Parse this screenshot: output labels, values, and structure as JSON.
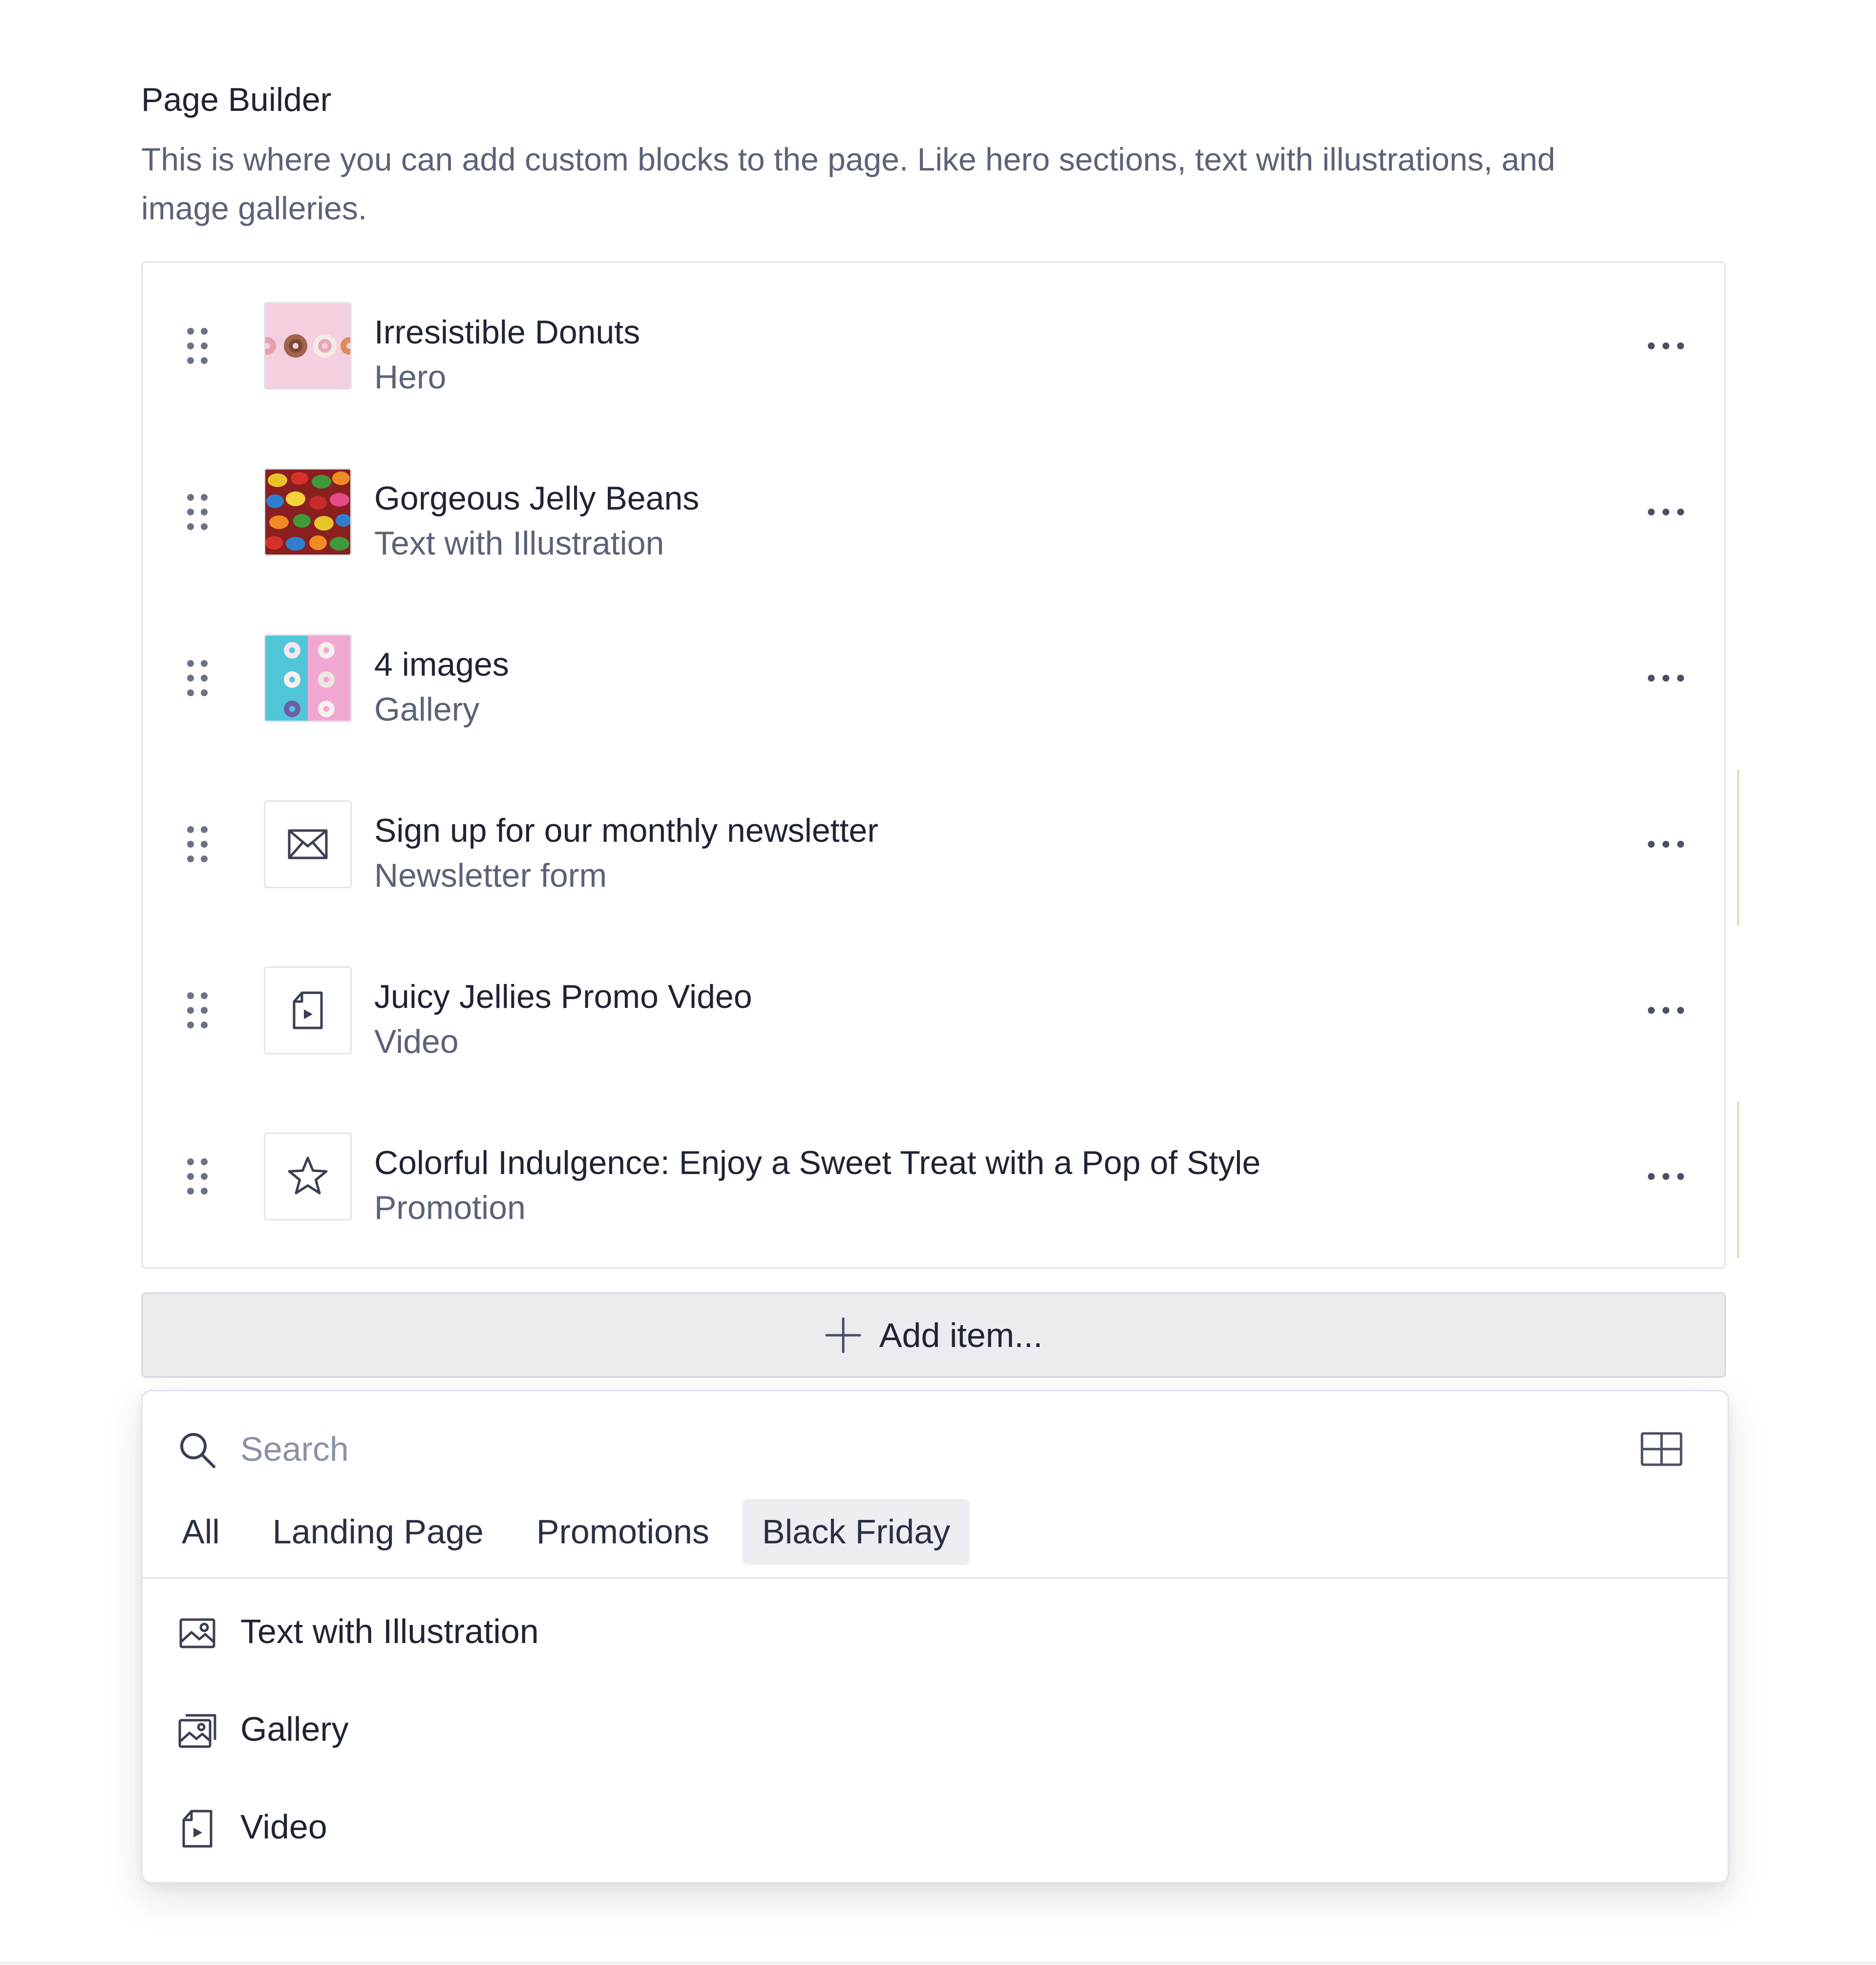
{
  "field": {
    "title": "Page Builder",
    "description": "This is where you can add custom blocks to the page. Like hero sections, text with illustrations, and image galleries."
  },
  "blocks": [
    {
      "title": "Irresistible Donuts",
      "type": "Hero",
      "thumb": "donuts-photo"
    },
    {
      "title": "Gorgeous Jelly Beans",
      "type": "Text with Illustration",
      "thumb": "jelly-beans-photo"
    },
    {
      "title": "4 images",
      "type": "Gallery",
      "thumb": "gallery-donuts-photo"
    },
    {
      "title": "Sign up for our monthly newsletter",
      "type": "Newsletter form",
      "thumb": "envelope-icon"
    },
    {
      "title": "Juicy Jellies Promo Video",
      "type": "Video",
      "thumb": "video-file-icon"
    },
    {
      "title": "Colorful Indulgence: Enjoy a Sweet Treat with a Pop of Style",
      "type": "Promotion",
      "thumb": "star-icon"
    }
  ],
  "add_button": {
    "label": "Add item..."
  },
  "picker": {
    "search_placeholder": "Search",
    "tabs": [
      "All",
      "Landing Page",
      "Promotions",
      "Black Friday"
    ],
    "active_tab": "Black Friday",
    "options": [
      {
        "label": "Text with Illustration",
        "icon": "image-icon"
      },
      {
        "label": "Gallery",
        "icon": "gallery-icon"
      },
      {
        "label": "Video",
        "icon": "video-file-icon"
      }
    ]
  },
  "colors": {
    "text": "#1f2433",
    "muted": "#5b6378",
    "border": "#e2e4ea",
    "active_tab_bg": "#eceef2"
  }
}
